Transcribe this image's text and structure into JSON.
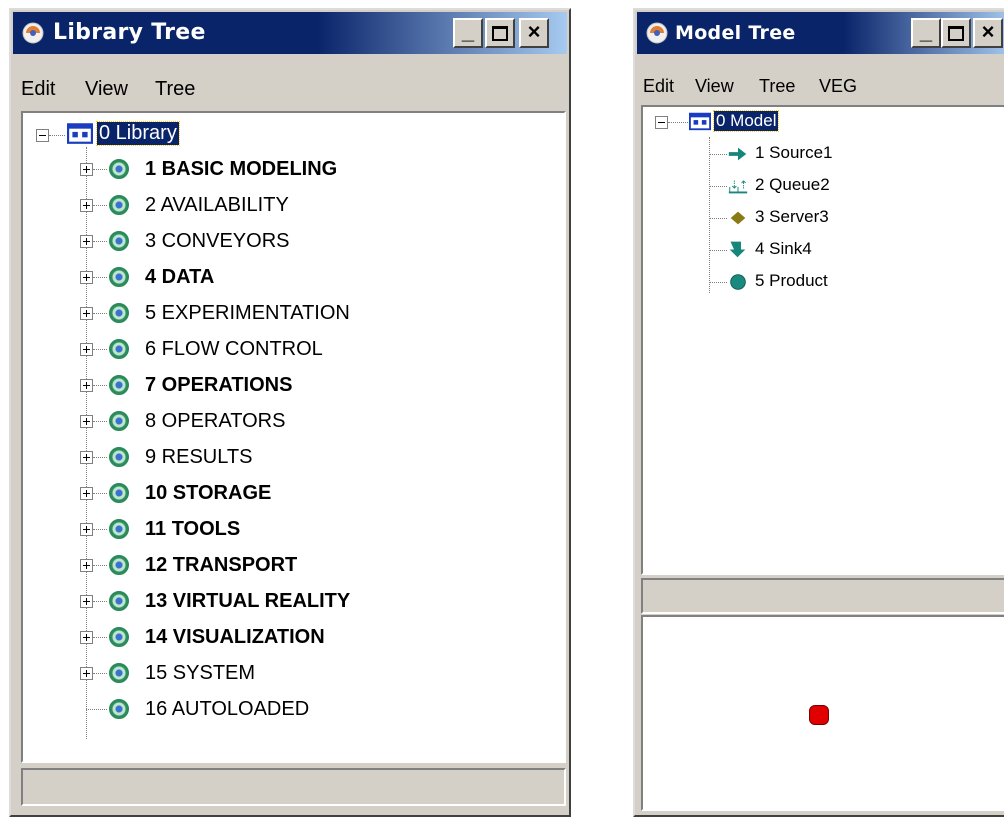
{
  "library_window": {
    "title": "Library Tree",
    "menu": [
      "Edit",
      "View",
      "Tree"
    ],
    "root": "0 Library",
    "items": [
      {
        "label": "1 BASIC MODELING",
        "expander": "plus"
      },
      {
        "label": "2 AVAILABILITY",
        "expander": "plus"
      },
      {
        "label": "3 CONVEYORS",
        "expander": "plus"
      },
      {
        "label": "4 DATA",
        "expander": "plus"
      },
      {
        "label": "5 EXPERIMENTATION",
        "expander": "plus"
      },
      {
        "label": "6 FLOW CONTROL",
        "expander": "plus"
      },
      {
        "label": "7 OPERATIONS",
        "expander": "plus"
      },
      {
        "label": "8 OPERATORS",
        "expander": "plus"
      },
      {
        "label": "9 RESULTS",
        "expander": "plus"
      },
      {
        "label": "10 STORAGE",
        "expander": "plus"
      },
      {
        "label": "11 TOOLS",
        "expander": "plus"
      },
      {
        "label": "12 TRANSPORT",
        "expander": "plus"
      },
      {
        "label": "13 VIRTUAL REALITY",
        "expander": "plus"
      },
      {
        "label": "14 VISUALIZATION",
        "expander": "plus"
      },
      {
        "label": "15 SYSTEM",
        "expander": "plus"
      },
      {
        "label": "16 AUTOLOADED",
        "expander": "none"
      }
    ]
  },
  "model_window": {
    "title": "Model Tree",
    "menu": [
      "Edit",
      "View",
      "Tree",
      "VEG"
    ],
    "root": "0 Model",
    "items": [
      {
        "label": "1 Source1",
        "icon": "source-arrow-icon"
      },
      {
        "label": "2 Queue2",
        "icon": "queue-icon"
      },
      {
        "label": "3 Server3",
        "icon": "server-diamond-icon"
      },
      {
        "label": "4 Sink4",
        "icon": "sink-arrow-icon"
      },
      {
        "label": "5 Product",
        "icon": "product-circle-icon"
      }
    ],
    "preview_dot_color": "#e00000"
  },
  "colors": {
    "title_active": "#0a246a",
    "window_face": "#d4d0c8",
    "teal": "#16857a",
    "olive": "#8a7a16"
  }
}
